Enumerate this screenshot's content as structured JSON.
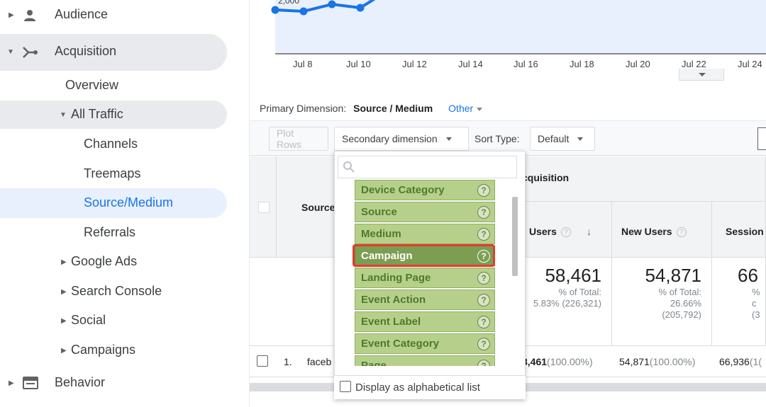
{
  "sidebar": {
    "audience": "Audience",
    "acquisition": "Acquisition",
    "overview": "Overview",
    "all_traffic": "All Traffic",
    "channels": "Channels",
    "treemaps": "Treemaps",
    "source_medium": "Source/Medium",
    "referrals": "Referrals",
    "google_ads": "Google Ads",
    "search_console": "Search Console",
    "social": "Social",
    "campaigns": "Campaigns",
    "behavior": "Behavior"
  },
  "chart": {
    "y_label": "2,000",
    "x_ticks": [
      "Jul 8",
      "Jul 10",
      "Jul 12",
      "Jul 14",
      "Jul 16",
      "Jul 18",
      "Jul 20",
      "Jul 22",
      "Jul 24"
    ],
    "line_color": "#1a73e8"
  },
  "primary_dimension": {
    "label": "Primary Dimension:",
    "selected": "Source / Medium",
    "other": "Other"
  },
  "toolbar": {
    "plot_rows": "Plot Rows",
    "secondary_dimension": "Secondary dimension",
    "sort_type_label": "Sort Type:",
    "sort_type_value": "Default"
  },
  "table": {
    "source_header": "Source",
    "acquisition_header": "cquisition",
    "users_header": "Users",
    "new_users_header": "New Users",
    "sessions_header": "Session",
    "totals": {
      "users": "58,461",
      "users_pct_label": "% of Total:",
      "users_pct": "5.83% (226,321)",
      "new_users": "54,871",
      "new_users_pct_label": "% of Total:",
      "new_users_pct": "26.66%",
      "new_users_total": "(205,792)",
      "sessions": "66",
      "sessions_pct_label": "% c",
      "sessions_total": "(3"
    },
    "rows": [
      {
        "index": "1.",
        "source": "faceb",
        "users": "8,461",
        "users_pct": "(100.00%)",
        "new_users": "54,871",
        "new_users_pct": "(100.00%)",
        "sessions": "66,936",
        "sessions_pct": "(1("
      }
    ]
  },
  "dropdown": {
    "search_placeholder": "",
    "options": [
      "Device Category",
      "Source",
      "Medium",
      "Campaign",
      "Landing Page",
      "Event Action",
      "Event Label",
      "Event Category",
      "Page"
    ],
    "selected_option": "Campaign",
    "help_glyph": "?",
    "alphabetical_label": "Display as alphabetical list",
    "highlight_color": "#e43b2c",
    "option_color": "#b6d08b",
    "selected_color": "#7c9e52"
  }
}
